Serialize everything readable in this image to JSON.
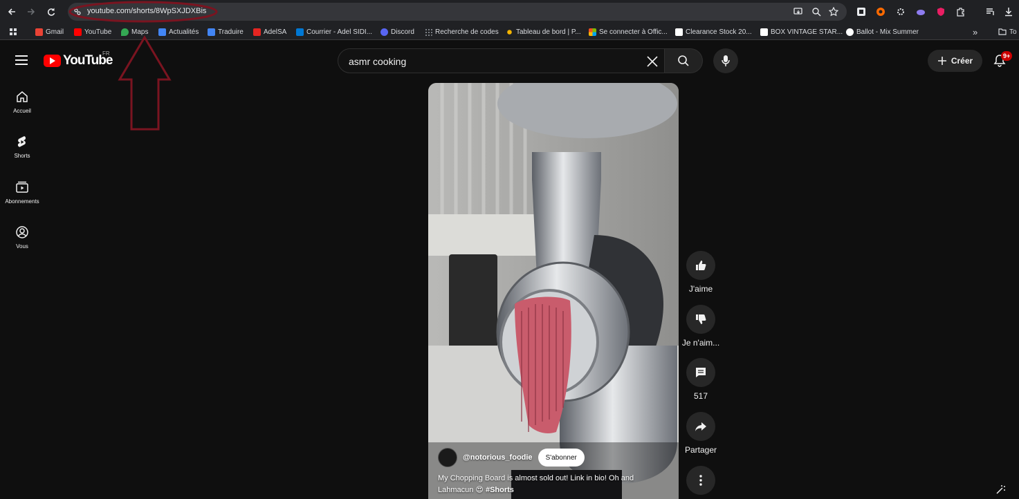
{
  "browser": {
    "url": "youtube.com/shorts/8WpSXJDXBis",
    "bookmarks": [
      {
        "label": "Gmail",
        "color": "#ea4335"
      },
      {
        "label": "YouTube",
        "color": "#ff0000"
      },
      {
        "label": "Maps",
        "color": "#34a853"
      },
      {
        "label": "Actualités",
        "color": "#4285f4"
      },
      {
        "label": "Traduire",
        "color": "#4285f4"
      },
      {
        "label": "AdelSA",
        "color": "#e52521"
      },
      {
        "label": "Courrier - Adel SIDI...",
        "color": "#0078d4"
      },
      {
        "label": "Discord",
        "color": "#5865f2"
      },
      {
        "label": "Recherche de codes",
        "color": "#9aa0a6"
      },
      {
        "label": "Tableau de bord | P...",
        "color": "#f4b400"
      },
      {
        "label": "Se connecter à Offic...",
        "color": "#f25022"
      },
      {
        "label": "Clearance Stock 20...",
        "color": "#ffffff"
      },
      {
        "label": "BOX VINTAGE STAR...",
        "color": "#ffffff"
      },
      {
        "label": "Ballot - Mix Summer",
        "color": "#ffffff"
      }
    ],
    "overflow_label": "»",
    "folder_label": "To"
  },
  "youtube": {
    "logo_text": "YouTube",
    "country_code": "FR",
    "search": {
      "query": "asmr cooking"
    },
    "create_label": "Créer",
    "notification_count": "9+",
    "sidebar": [
      {
        "label": "Accueil",
        "icon": "home-icon"
      },
      {
        "label": "Shorts",
        "icon": "shorts-icon"
      },
      {
        "label": "Abonnements",
        "icon": "subscriptions-icon"
      },
      {
        "label": "Vous",
        "icon": "you-icon"
      }
    ],
    "short": {
      "channel": "@notorious_foodie",
      "subscribe_label": "S'abonner",
      "caption": "My Chopping Board is almost sold out! Link in bio! Oh and Lahmacun 😍",
      "hashtag": "#Shorts"
    },
    "actions": {
      "like": "J'aime",
      "dislike": "Je n'aim...",
      "comments": "517",
      "share": "Partager"
    }
  },
  "colors": {
    "accent": "#ff0000",
    "annotation": "#7a1420"
  }
}
